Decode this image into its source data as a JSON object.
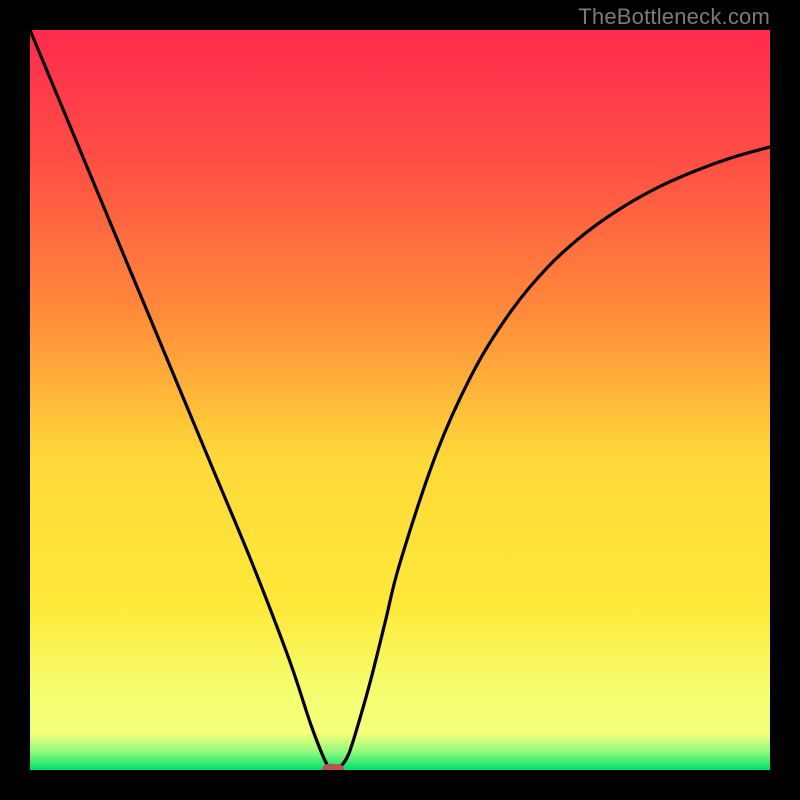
{
  "watermark": {
    "text": "TheBottleneck.com"
  },
  "chart_data": {
    "type": "line",
    "title": "",
    "xlabel": "",
    "ylabel": "",
    "xlim": [
      0,
      100
    ],
    "ylim": [
      0,
      100
    ],
    "gradient_colors": {
      "top": "#ff2b4e",
      "mid_upper": "#ff8a3a",
      "mid": "#ffe93a",
      "lower": "#f7ff7a",
      "bottom": "#00e06a"
    },
    "series": [
      {
        "name": "bottleneck-curve",
        "x": [
          0,
          5,
          10,
          15,
          20,
          25,
          30,
          35,
          38,
          40,
          41,
          42,
          43,
          44,
          46,
          48,
          50,
          55,
          60,
          65,
          70,
          75,
          80,
          85,
          90,
          95,
          100
        ],
        "y": [
          100,
          88,
          76,
          64,
          52,
          40,
          28,
          15,
          6,
          1,
          0,
          0.5,
          2,
          5,
          12,
          20,
          28,
          43,
          54,
          62,
          68,
          72.5,
          76,
          78.8,
          81,
          82.8,
          84.2
        ]
      }
    ],
    "marker": {
      "x": 41,
      "y": 0,
      "color": "#b6564f"
    }
  }
}
